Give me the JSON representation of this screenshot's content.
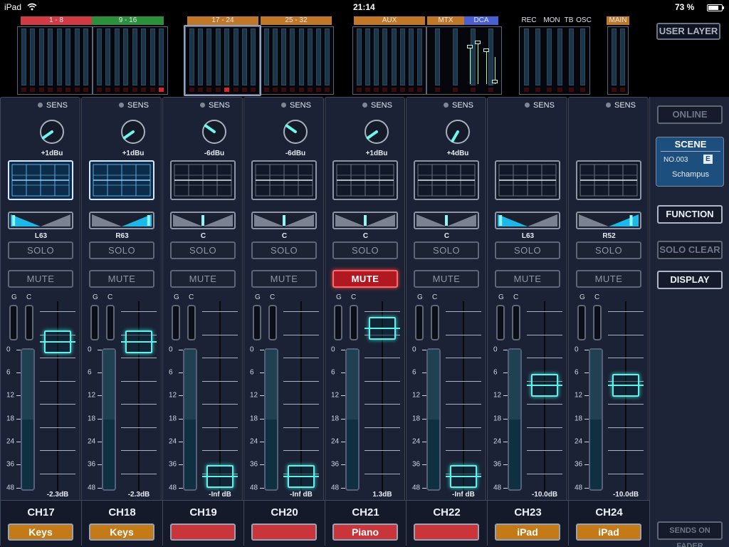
{
  "status_bar": {
    "device": "iPad",
    "time": "21:14",
    "battery": "73 %"
  },
  "overview": {
    "groups": [
      {
        "label": "1 - 8",
        "color": "#d03a44"
      },
      {
        "label": "9 - 16",
        "color": "#2b8f3c"
      },
      {
        "label": "17 - 24",
        "color": "#c07828"
      },
      {
        "label": "25 - 32",
        "color": "#c07828"
      },
      {
        "label": "AUX",
        "color": "#c07828"
      },
      {
        "label": "MTX",
        "color": "#c07828"
      },
      {
        "label": "DCA",
        "color": "#4a5fd0"
      },
      {
        "label": "REC",
        "color": ""
      },
      {
        "label": "MON",
        "color": ""
      },
      {
        "label": "TB",
        "color": ""
      },
      {
        "label": "OSC",
        "color": ""
      },
      {
        "label": "MAIN",
        "color": "#c07828"
      }
    ],
    "user_layer_label": "USER LAYER"
  },
  "channels": [
    {
      "number": "CH17",
      "name": "Keys",
      "name_color": "#c47a16",
      "gain": "+1dBu",
      "knob_angle": -125,
      "eq_on": true,
      "pan_label": "L63",
      "pan": -0.9,
      "solo_label": "SOLO",
      "mute_label": "MUTE",
      "mute_on": false,
      "fader": "-2.3dB",
      "fader_pos": 0.78,
      "fader_scale": [
        "0",
        "6",
        "12",
        "18",
        "24",
        "36",
        "48"
      ]
    },
    {
      "number": "CH18",
      "name": "Keys",
      "name_color": "#c47a16",
      "gain": "+1dBu",
      "knob_angle": -125,
      "eq_on": true,
      "pan_label": "R63",
      "pan": 0.9,
      "solo_label": "SOLO",
      "mute_label": "MUTE",
      "mute_on": false,
      "fader": "-2.3dB",
      "fader_pos": 0.78,
      "fader_scale": [
        "0",
        "6",
        "12",
        "18",
        "24",
        "36",
        "48"
      ]
    },
    {
      "number": "CH19",
      "name": "",
      "name_color": "#c9353a",
      "gain": "-6dBu",
      "knob_angle": -55,
      "eq_on": false,
      "pan_label": "C",
      "pan": 0,
      "solo_label": "SOLO",
      "mute_label": "MUTE",
      "mute_on": false,
      "fader": "-Inf dB",
      "fader_pos": 0.0,
      "fader_scale": [
        "0",
        "6",
        "12",
        "18",
        "24",
        "36",
        "48"
      ]
    },
    {
      "number": "CH20",
      "name": "",
      "name_color": "#c9353a",
      "gain": "-6dBu",
      "knob_angle": -55,
      "eq_on": false,
      "pan_label": "C",
      "pan": 0,
      "solo_label": "SOLO",
      "mute_label": "MUTE",
      "mute_on": false,
      "fader": "-Inf dB",
      "fader_pos": 0.0,
      "fader_scale": [
        "0",
        "6",
        "12",
        "18",
        "24",
        "36",
        "48"
      ]
    },
    {
      "number": "CH21",
      "name": "Piano",
      "name_color": "#c9353a",
      "gain": "+1dBu",
      "knob_angle": -125,
      "eq_on": false,
      "pan_label": "C",
      "pan": 0,
      "solo_label": "SOLO",
      "mute_label": "MUTE",
      "mute_on": true,
      "fader": "1.3dB",
      "fader_pos": 0.86,
      "fader_scale": [
        "0",
        "6",
        "12",
        "18",
        "24",
        "36",
        "48"
      ]
    },
    {
      "number": "CH22",
      "name": "",
      "name_color": "#c9353a",
      "gain": "+4dBu",
      "knob_angle": -150,
      "eq_on": false,
      "pan_label": "C",
      "pan": 0,
      "solo_label": "SOLO",
      "mute_label": "MUTE",
      "mute_on": false,
      "fader": "-Inf dB",
      "fader_pos": 0.0,
      "fader_scale": [
        "0",
        "6",
        "12",
        "18",
        "24",
        "36",
        "48"
      ]
    },
    {
      "number": "CH23",
      "name": "iPad",
      "name_color": "#c47a16",
      "gain": "",
      "knob_angle": null,
      "eq_on": false,
      "pan_label": "L63",
      "pan": -0.9,
      "solo_label": "SOLO",
      "mute_label": "MUTE",
      "mute_on": false,
      "fader": "-10.0dB",
      "fader_pos": 0.53,
      "fader_scale": [
        "0",
        "6",
        "12",
        "18",
        "24",
        "36",
        "48"
      ]
    },
    {
      "number": "CH24",
      "name": "iPad",
      "name_color": "#c47a16",
      "gain": "",
      "knob_angle": null,
      "eq_on": false,
      "pan_label": "R52",
      "pan": 0.75,
      "solo_label": "SOLO",
      "mute_label": "MUTE",
      "mute_on": false,
      "fader": "-10.0dB",
      "fader_pos": 0.53,
      "fader_scale": [
        "0",
        "6",
        "12",
        "18",
        "24",
        "36",
        "48"
      ]
    }
  ],
  "gc_labels": {
    "g": "G",
    "c": "C"
  },
  "sens_label": "SENS",
  "right_panel": {
    "online_label": "ONLINE",
    "scene": {
      "title": "SCENE",
      "number": "NO.003",
      "badge": "E",
      "name": "Schampus"
    },
    "function_label": "FUNCTION",
    "solo_clear_label": "SOLO CLEAR",
    "display_label": "DISPLAY",
    "sends_on_fader_label": "SENDS ON FADER"
  },
  "icons": {
    "wifi": "wifi-icon",
    "bluetooth": "bluetooth-icon",
    "battery": "battery-icon"
  }
}
